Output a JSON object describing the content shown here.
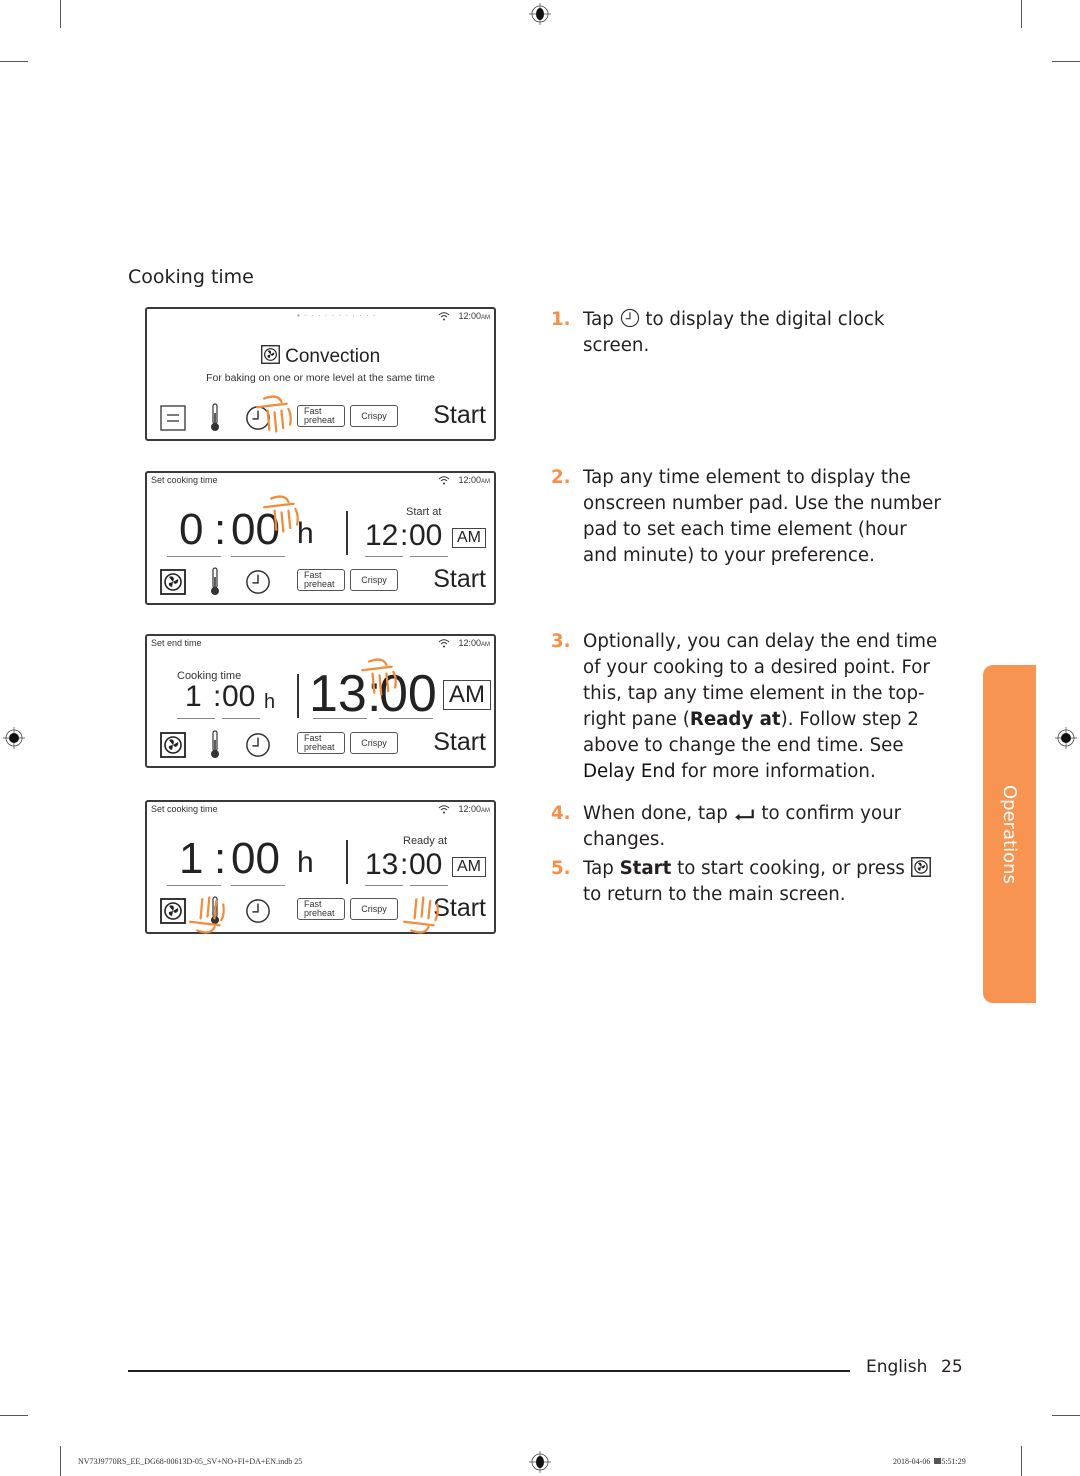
{
  "section_title": "Cooking time",
  "panels": [
    {
      "top_label": "",
      "page_dots": "• · · · · · · · · · · ·",
      "clock": "12:00",
      "clock_ampm": "AM",
      "mode_name": "Convection",
      "mode_desc": "For baking on one or more level at the  same time",
      "toolbar": {
        "fast_line1": "Fast",
        "fast_line2": "preheat",
        "crispy": "Crispy",
        "start": "Start"
      },
      "first_icon": "menu-icon",
      "tap_target": "clock-icon"
    },
    {
      "top_label": "Set cooking time",
      "clock": "12:00",
      "clock_ampm": "AM",
      "duration_hours": "0",
      "duration_minutes": "00",
      "duration_unit": "h",
      "right_label": "Start at",
      "right_time_hours": "12",
      "right_time_minutes": "00",
      "right_ampm": "AM",
      "toolbar": {
        "fast_line1": "Fast",
        "fast_line2": "preheat",
        "crispy": "Crispy",
        "start": "Start"
      },
      "first_icon": "convection-icon",
      "tap_target": "duration-minutes"
    },
    {
      "top_label": "Set end time",
      "clock": "12:00",
      "clock_ampm": "AM",
      "left_label": "Cooking time",
      "duration_hours": "1",
      "duration_minutes": "00",
      "duration_unit": "h",
      "right_time_hours": "13",
      "right_time_minutes": "00",
      "right_ampm": "AM",
      "toolbar": {
        "fast_line1": "Fast",
        "fast_line2": "preheat",
        "crispy": "Crispy",
        "start": "Start"
      },
      "first_icon": "convection-icon",
      "tap_target": "end-time"
    },
    {
      "top_label": "Set cooking time",
      "clock": "12:00",
      "clock_ampm": "AM",
      "duration_hours": "1",
      "duration_minutes": "00",
      "duration_unit": "h",
      "right_label": "Ready at",
      "right_time_hours": "13",
      "right_time_minutes": "00",
      "right_ampm": "AM",
      "toolbar": {
        "fast_line1": "Fast",
        "fast_line2": "preheat",
        "crispy": "Crispy",
        "start": "Start"
      },
      "first_icon": "convection-icon",
      "tap_target": "start-button"
    }
  ],
  "steps": [
    {
      "num": "1.",
      "pre": "Tap",
      "icon": "clock-icon",
      "post": "to display the digital clock screen."
    },
    {
      "num": "2.",
      "text": "Tap any time element to display the onscreen number pad. Use the number pad to set each time element (hour and minute) to your preference."
    },
    {
      "num": "3.",
      "pre": "Optionally, you can delay the end time of your cooking to a desired point. For this, tap any time element in the top-right pane (",
      "bold": "Ready at",
      "mid": "). Follow step 2 above to change the end time. See ",
      "link": "Delay End",
      "post": " for more information."
    },
    {
      "num": "4.",
      "pre": "When done, tap",
      "icon": "enter-icon",
      "post": "to confirm your changes."
    },
    {
      "num": "5.",
      "pre": "Tap ",
      "bold": "Start",
      "mid": " to start cooking, or press",
      "icon": "convection-icon",
      "post": "to return to the main screen."
    }
  ],
  "side_tab": {
    "label": "Operations",
    "color": "#f79452"
  },
  "accent_color": "#f58f4a",
  "footer": {
    "language": "English",
    "page": "25"
  },
  "slug": {
    "file": "NV73J9770RS_EE_DG68-00613D-05_SV+NO+FI+DA+EN.indb   25",
    "date": "2018-04-06",
    "time": "5:51:29"
  }
}
